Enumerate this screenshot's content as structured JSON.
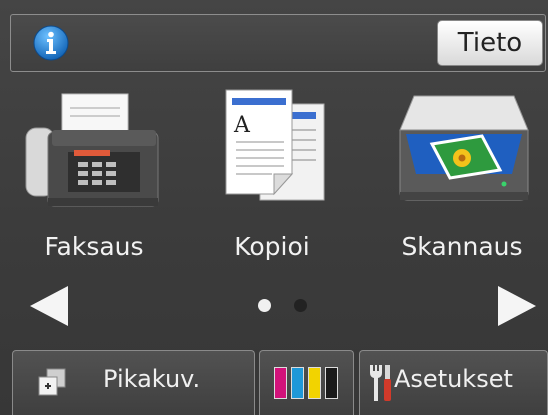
{
  "topbar": {
    "info_icon": "info-icon",
    "info_button_label": "Tieto"
  },
  "apps": [
    {
      "label": "Faksaus",
      "icon": "fax-icon"
    },
    {
      "label": "Kopioi",
      "icon": "copy-icon"
    },
    {
      "label": "Skannaus",
      "icon": "scanner-icon"
    }
  ],
  "pager": {
    "current_page": 1,
    "total_pages": 2
  },
  "bottom": {
    "shortcut_label": "Pikakuv.",
    "ink_colors": [
      "#d2127a",
      "#1e98d8",
      "#f2d300",
      "#1a1a1a"
    ],
    "settings_label": "Asetukset"
  },
  "colors": {
    "accent": "#2f8fd8",
    "background": "#3d3d3d"
  }
}
